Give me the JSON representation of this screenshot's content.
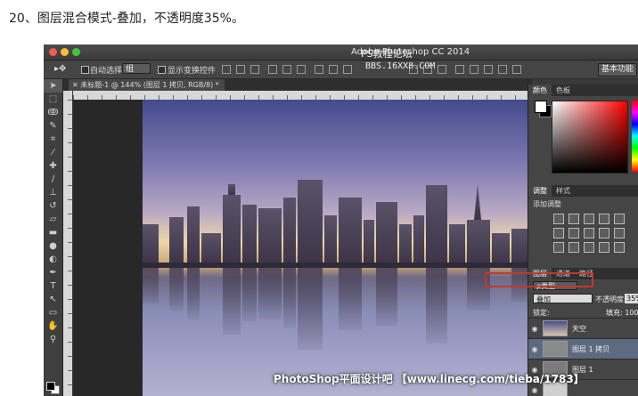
{
  "step_title": "20、图层混合模式-叠加，不透明度35%。",
  "app": {
    "title": "Adobe Photoshop CC 2014",
    "watermark_forum": "PS教程论坛",
    "watermark_bbs": "BBS.16XX8.COM"
  },
  "options_bar": {
    "move_tool_icon": "move-icon",
    "auto_select_label": "自动选择:",
    "auto_select_value": "组",
    "show_transform_label": "显示变换控件",
    "workspace_button": "基本功能"
  },
  "document": {
    "tab_label": "未标题-1 @ 144% (图层 1 拷贝, RGB/8) *"
  },
  "panels": {
    "color_tabs": [
      "颜色",
      "色板"
    ],
    "adjust_tabs": [
      "调整",
      "样式"
    ],
    "adjust_title": "添加调整",
    "layers_tabs": [
      "图层",
      "通道",
      "路径"
    ],
    "filter_kind": "ρ类型",
    "blend_mode": "叠加",
    "opacity_label": "不透明度:",
    "opacity_value": "35%",
    "lock_label": "锁定:",
    "fill_label": "填充: 100%",
    "layers": [
      {
        "name": "天空",
        "selected": false
      },
      {
        "name": "图层 1 拷贝",
        "selected": true
      },
      {
        "name": "图层 1",
        "selected": false
      }
    ]
  },
  "footer_watermark": "PhotoShop平面设计吧 【www.linecg.com/tieba/1783】"
}
